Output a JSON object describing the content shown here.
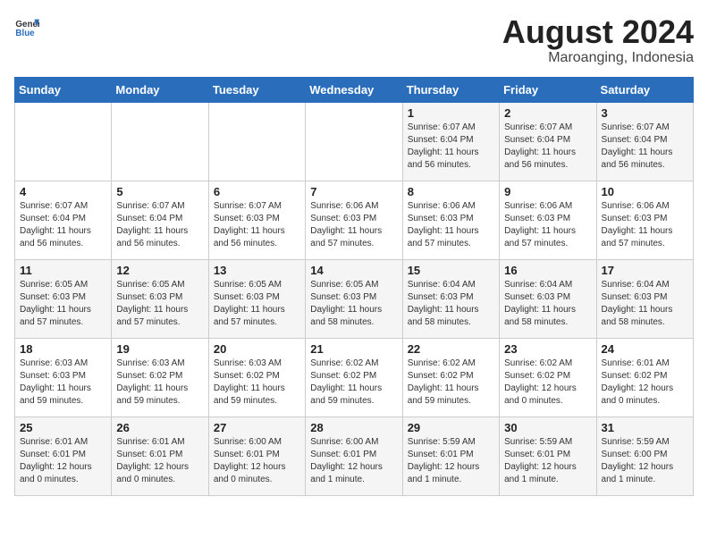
{
  "header": {
    "logo_line1": "General",
    "logo_line2": "Blue",
    "title": "August 2024",
    "subtitle": "Maroanging, Indonesia"
  },
  "days_of_week": [
    "Sunday",
    "Monday",
    "Tuesday",
    "Wednesday",
    "Thursday",
    "Friday",
    "Saturday"
  ],
  "weeks": [
    [
      {
        "num": "",
        "info": ""
      },
      {
        "num": "",
        "info": ""
      },
      {
        "num": "",
        "info": ""
      },
      {
        "num": "",
        "info": ""
      },
      {
        "num": "1",
        "info": "Sunrise: 6:07 AM\nSunset: 6:04 PM\nDaylight: 11 hours\nand 56 minutes."
      },
      {
        "num": "2",
        "info": "Sunrise: 6:07 AM\nSunset: 6:04 PM\nDaylight: 11 hours\nand 56 minutes."
      },
      {
        "num": "3",
        "info": "Sunrise: 6:07 AM\nSunset: 6:04 PM\nDaylight: 11 hours\nand 56 minutes."
      }
    ],
    [
      {
        "num": "4",
        "info": "Sunrise: 6:07 AM\nSunset: 6:04 PM\nDaylight: 11 hours\nand 56 minutes."
      },
      {
        "num": "5",
        "info": "Sunrise: 6:07 AM\nSunset: 6:04 PM\nDaylight: 11 hours\nand 56 minutes."
      },
      {
        "num": "6",
        "info": "Sunrise: 6:07 AM\nSunset: 6:03 PM\nDaylight: 11 hours\nand 56 minutes."
      },
      {
        "num": "7",
        "info": "Sunrise: 6:06 AM\nSunset: 6:03 PM\nDaylight: 11 hours\nand 57 minutes."
      },
      {
        "num": "8",
        "info": "Sunrise: 6:06 AM\nSunset: 6:03 PM\nDaylight: 11 hours\nand 57 minutes."
      },
      {
        "num": "9",
        "info": "Sunrise: 6:06 AM\nSunset: 6:03 PM\nDaylight: 11 hours\nand 57 minutes."
      },
      {
        "num": "10",
        "info": "Sunrise: 6:06 AM\nSunset: 6:03 PM\nDaylight: 11 hours\nand 57 minutes."
      }
    ],
    [
      {
        "num": "11",
        "info": "Sunrise: 6:05 AM\nSunset: 6:03 PM\nDaylight: 11 hours\nand 57 minutes."
      },
      {
        "num": "12",
        "info": "Sunrise: 6:05 AM\nSunset: 6:03 PM\nDaylight: 11 hours\nand 57 minutes."
      },
      {
        "num": "13",
        "info": "Sunrise: 6:05 AM\nSunset: 6:03 PM\nDaylight: 11 hours\nand 57 minutes."
      },
      {
        "num": "14",
        "info": "Sunrise: 6:05 AM\nSunset: 6:03 PM\nDaylight: 11 hours\nand 58 minutes."
      },
      {
        "num": "15",
        "info": "Sunrise: 6:04 AM\nSunset: 6:03 PM\nDaylight: 11 hours\nand 58 minutes."
      },
      {
        "num": "16",
        "info": "Sunrise: 6:04 AM\nSunset: 6:03 PM\nDaylight: 11 hours\nand 58 minutes."
      },
      {
        "num": "17",
        "info": "Sunrise: 6:04 AM\nSunset: 6:03 PM\nDaylight: 11 hours\nand 58 minutes."
      }
    ],
    [
      {
        "num": "18",
        "info": "Sunrise: 6:03 AM\nSunset: 6:03 PM\nDaylight: 11 hours\nand 59 minutes."
      },
      {
        "num": "19",
        "info": "Sunrise: 6:03 AM\nSunset: 6:02 PM\nDaylight: 11 hours\nand 59 minutes."
      },
      {
        "num": "20",
        "info": "Sunrise: 6:03 AM\nSunset: 6:02 PM\nDaylight: 11 hours\nand 59 minutes."
      },
      {
        "num": "21",
        "info": "Sunrise: 6:02 AM\nSunset: 6:02 PM\nDaylight: 11 hours\nand 59 minutes."
      },
      {
        "num": "22",
        "info": "Sunrise: 6:02 AM\nSunset: 6:02 PM\nDaylight: 11 hours\nand 59 minutes."
      },
      {
        "num": "23",
        "info": "Sunrise: 6:02 AM\nSunset: 6:02 PM\nDaylight: 12 hours\nand 0 minutes."
      },
      {
        "num": "24",
        "info": "Sunrise: 6:01 AM\nSunset: 6:02 PM\nDaylight: 12 hours\nand 0 minutes."
      }
    ],
    [
      {
        "num": "25",
        "info": "Sunrise: 6:01 AM\nSunset: 6:01 PM\nDaylight: 12 hours\nand 0 minutes."
      },
      {
        "num": "26",
        "info": "Sunrise: 6:01 AM\nSunset: 6:01 PM\nDaylight: 12 hours\nand 0 minutes."
      },
      {
        "num": "27",
        "info": "Sunrise: 6:00 AM\nSunset: 6:01 PM\nDaylight: 12 hours\nand 0 minutes."
      },
      {
        "num": "28",
        "info": "Sunrise: 6:00 AM\nSunset: 6:01 PM\nDaylight: 12 hours\nand 1 minute."
      },
      {
        "num": "29",
        "info": "Sunrise: 5:59 AM\nSunset: 6:01 PM\nDaylight: 12 hours\nand 1 minute."
      },
      {
        "num": "30",
        "info": "Sunrise: 5:59 AM\nSunset: 6:01 PM\nDaylight: 12 hours\nand 1 minute."
      },
      {
        "num": "31",
        "info": "Sunrise: 5:59 AM\nSunset: 6:00 PM\nDaylight: 12 hours\nand 1 minute."
      }
    ]
  ]
}
